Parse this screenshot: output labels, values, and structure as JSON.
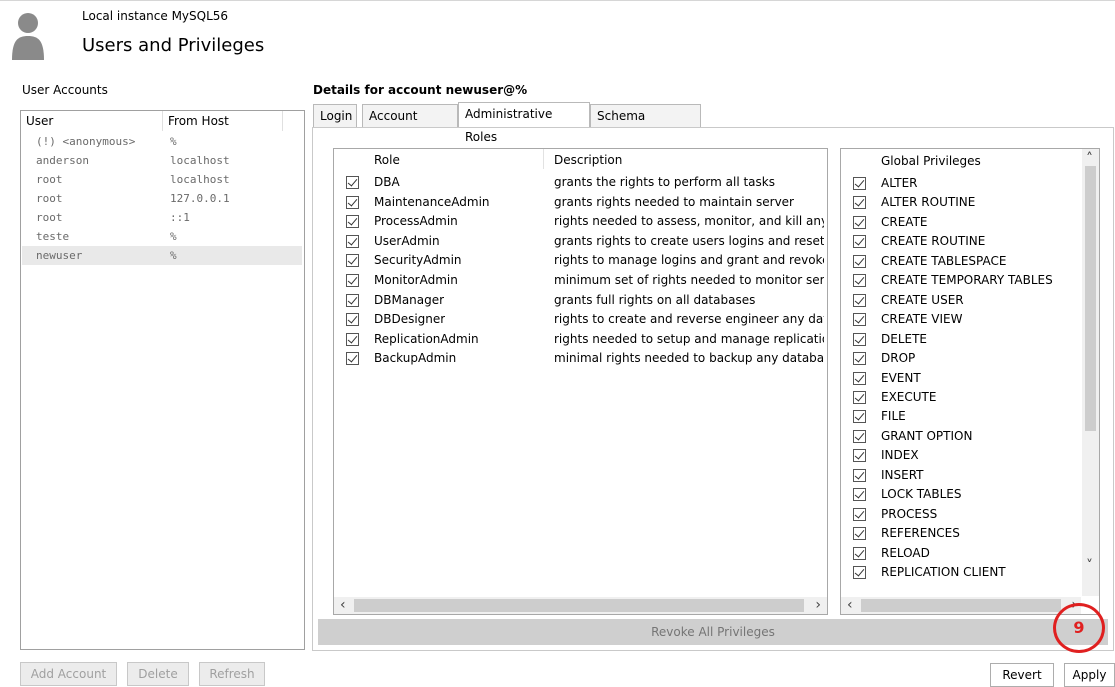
{
  "header": {
    "instance": "Local instance MySQL56",
    "title": "Users and Privileges"
  },
  "accounts": {
    "section_label": "User Accounts",
    "columns": [
      "User",
      "From Host"
    ],
    "rows": [
      {
        "user": "(!) <anonymous>",
        "host": "%"
      },
      {
        "user": "anderson",
        "host": "localhost"
      },
      {
        "user": "root",
        "host": "localhost"
      },
      {
        "user": "root",
        "host": "127.0.0.1"
      },
      {
        "user": "root",
        "host": "::1"
      },
      {
        "user": "teste",
        "host": "%"
      },
      {
        "user": "newuser",
        "host": "%"
      }
    ],
    "selected_index": 6,
    "buttons": {
      "add": "Add Account",
      "delete": "Delete",
      "refresh": "Refresh"
    }
  },
  "details": {
    "heading": "Details for account newuser@%",
    "tabs": [
      "Login",
      "Account Limits",
      "Administrative Roles",
      "Schema Privileges"
    ],
    "active_tab": "Administrative Roles"
  },
  "roles": {
    "columns": [
      "Role",
      "Description"
    ],
    "rows": [
      {
        "role": "DBA",
        "desc": "grants the rights to perform all tasks"
      },
      {
        "role": "MaintenanceAdmin",
        "desc": "grants rights needed to maintain server"
      },
      {
        "role": "ProcessAdmin",
        "desc": "rights needed to assess, monitor, and kill any"
      },
      {
        "role": "UserAdmin",
        "desc": "grants rights to create users logins and reset p"
      },
      {
        "role": "SecurityAdmin",
        "desc": "rights to manage logins and grant and revoke"
      },
      {
        "role": "MonitorAdmin",
        "desc": "minimum set of rights needed to monitor serv"
      },
      {
        "role": "DBManager",
        "desc": "grants full rights on all databases"
      },
      {
        "role": "DBDesigner",
        "desc": "rights to create and reverse engineer any data"
      },
      {
        "role": "ReplicationAdmin",
        "desc": "rights needed to setup and manage replicatio"
      },
      {
        "role": "BackupAdmin",
        "desc": "minimal rights needed to backup any databas"
      }
    ]
  },
  "privileges": {
    "header": "Global Privileges",
    "items": [
      "ALTER",
      "ALTER ROUTINE",
      "CREATE",
      "CREATE ROUTINE",
      "CREATE TABLESPACE",
      "CREATE TEMPORARY TABLES",
      "CREATE USER",
      "CREATE VIEW",
      "DELETE",
      "DROP",
      "EVENT",
      "EXECUTE",
      "FILE",
      "GRANT OPTION",
      "INDEX",
      "INSERT",
      "LOCK TABLES",
      "PROCESS",
      "REFERENCES",
      "RELOAD",
      "REPLICATION CLIENT"
    ]
  },
  "actions": {
    "revoke": "Revoke All Privileges",
    "revert": "Revert",
    "apply": "Apply"
  },
  "badge": "9",
  "colors": {
    "badge": "#e02020",
    "selected_row": "#e9e9e9"
  }
}
